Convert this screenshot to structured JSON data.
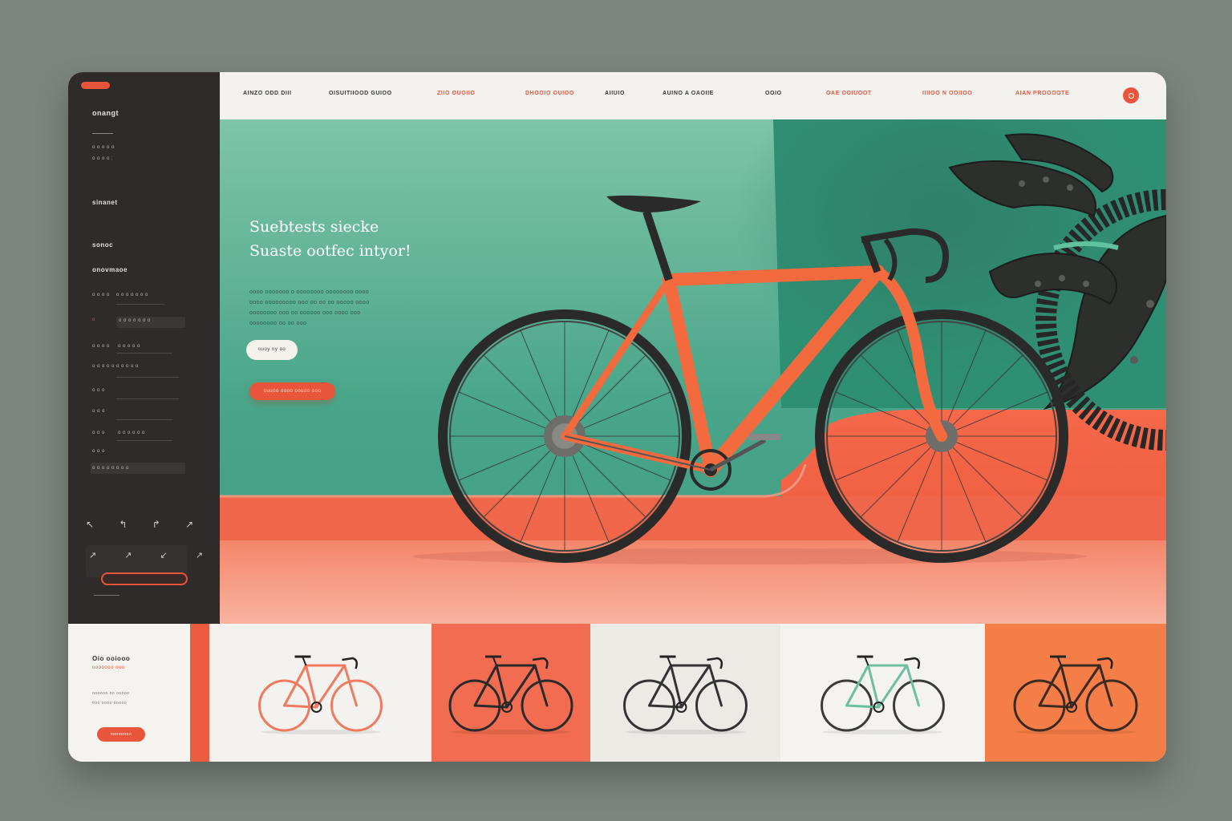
{
  "sidebar": {
    "logo_text": "onangt",
    "meta_line1": "o o o o  o",
    "meta_line2": "o o o  o ;",
    "section1": "sinanet",
    "section2": "sonoc",
    "section3": "onovmaoe",
    "rows": [
      {
        "label": "o o o  o",
        "value": "o o o o o o o"
      },
      {
        "label": "o",
        "value": "o o o o o o o"
      },
      {
        "label": "o o o o",
        "value": "o o o o o"
      },
      {
        "label": "o o o o o",
        "value": "o o o o o"
      },
      {
        "label": "o o o",
        "value": ""
      },
      {
        "label": "o o o",
        "value": ""
      },
      {
        "label": "o o o",
        "value": "o o o o o o"
      },
      {
        "label": "o o o",
        "value": ""
      },
      {
        "label": "o o o o  o o o o",
        "value": ""
      }
    ],
    "icons_row1": "↖ ↰ ↱ ↗ ↯",
    "icons_row2": "↗ ↗ ↙ ↗ ↗"
  },
  "nav": {
    "items": [
      {
        "label": "AINZO ODD DIII",
        "accent": false
      },
      {
        "label": "OISUITIIOOD GUIOO",
        "accent": false
      },
      {
        "label": "ZIIO OUOIIO",
        "accent": true
      },
      {
        "label": "DHOOIO OUIOO",
        "accent": true
      },
      {
        "label": "AIIUIO",
        "accent": false
      },
      {
        "label": "AUINO A OAOIIE",
        "accent": false
      },
      {
        "label": "OOIO",
        "accent": false
      },
      {
        "label": "OAE OOIUOOT",
        "accent": true
      },
      {
        "label": "IIIIOO N OOIIOO",
        "accent": true
      },
      {
        "label": "AIAN PROOOOTE",
        "accent": true
      }
    ]
  },
  "hero": {
    "title_line1": "Suebtests siecke",
    "title_line2": "Suaste ootfec intyor!",
    "desc": [
      "oooo  ooooooo  o  oooooooo  oooooooo oooo",
      "oooo ooooooooo  ooo oo oo oo ooooo oooo",
      "oooooooo ooo  oo oooooo ooo  oooo ooo",
      "oooooooo oo  oo ooo"
    ],
    "btn_white": "ouoy ny oo",
    "btn_orange": "ouuoo oooo oouoo ooo",
    "colors": {
      "green": "#4aa68a",
      "coral": "#f0664a",
      "frame": "#f26a3d",
      "dark": "#2b2b2b"
    }
  },
  "bottom": {
    "info_title": "Oio ooiooo",
    "info_sub": "ooooooo ooo",
    "info_lines": [
      "oooooo  oo  ooooo",
      "ooo  oooo  ooooo"
    ],
    "info_btn": "oooooooo",
    "tiles": [
      {
        "bg": "#f4f2ef",
        "frame": "#f07a60",
        "wheel": "#f07a60"
      },
      {
        "bg": "#f26c52",
        "frame": "#2a2a2a",
        "wheel": "#2a2a2a"
      },
      {
        "bg": "#eceae5",
        "frame": "#333333",
        "wheel": "#333333"
      },
      {
        "bg": "#f4f3f0",
        "frame": "#6dbfa1",
        "wheel": "#3a3a3a"
      },
      {
        "bg": "#f57d48",
        "frame": "#3a2a22",
        "wheel": "#3a2a22"
      }
    ]
  }
}
